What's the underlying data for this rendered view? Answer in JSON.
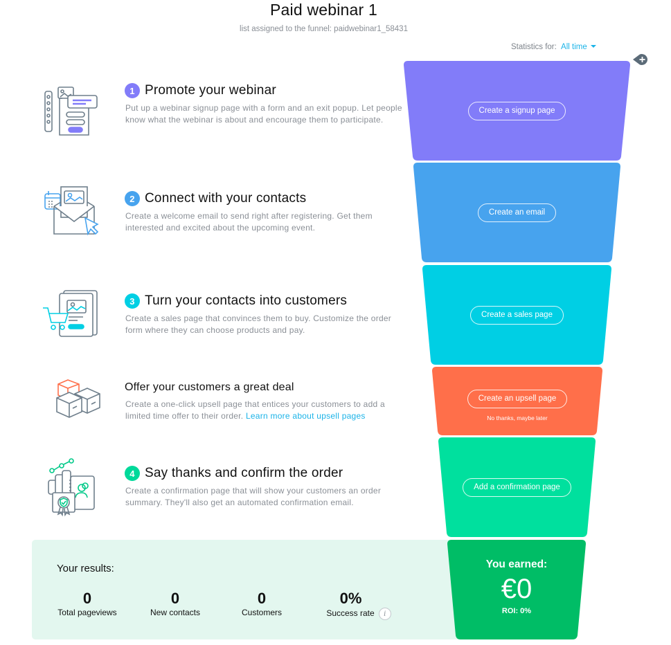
{
  "header": {
    "title": "Paid webinar 1",
    "subtitle": "list assigned to the funnel: paidwebinar1_58431"
  },
  "statistics": {
    "label": "Statistics for:",
    "period": "All time"
  },
  "add_step_icon": "plus-icon",
  "colors": {
    "step1": "#827cf9",
    "step2": "#47a3ee",
    "step3": "#00cfe4",
    "upsell": "#ff6f4a",
    "step4": "#00e09e",
    "earned": "#00bd66",
    "link": "#1ab3e8",
    "results_bg": "#e3f7ef"
  },
  "steps": [
    {
      "number": "1",
      "title": "Promote your webinar",
      "description": "Put up a webinar signup page with a form and an exit popup. Let people know what the webinar is about and encourage them to participate.",
      "icon": "signup-page-icon",
      "action": "Create a signup page"
    },
    {
      "number": "2",
      "title": "Connect with your contacts",
      "description": "Create a welcome email to send right after registering. Get them interested and excited about the upcoming event.",
      "icon": "email-icon",
      "action": "Create an email"
    },
    {
      "number": "3",
      "title": "Turn your contacts into customers",
      "description": "Create a sales page that convinces them to buy. Customize the order form where they can choose products and pay.",
      "icon": "sales-page-icon",
      "action": "Create a sales page"
    },
    {
      "number": "",
      "title": "Offer your customers a great deal",
      "description": "Create a one-click upsell page that entices your customers to add a limited time offer to their order.",
      "link": "Learn more about upsell pages",
      "icon": "boxes-icon",
      "action": "Create an upsell page",
      "skip": "No thanks, maybe later"
    },
    {
      "number": "4",
      "title": "Say thanks and confirm the order",
      "description": "Create a confirmation page that will show your customers an order summary. They'll also get an automated confirmation email.",
      "icon": "confirmation-icon",
      "action": "Add a confirmation page"
    }
  ],
  "results": {
    "heading": "Your results:",
    "metrics": [
      {
        "value": "0",
        "label": "Total pageviews"
      },
      {
        "value": "0",
        "label": "New contacts"
      },
      {
        "value": "0",
        "label": "Customers"
      },
      {
        "value": "0%",
        "label": "Success rate"
      }
    ]
  },
  "earned": {
    "label": "You earned:",
    "amount": "€0",
    "roi": "ROI: 0%"
  }
}
